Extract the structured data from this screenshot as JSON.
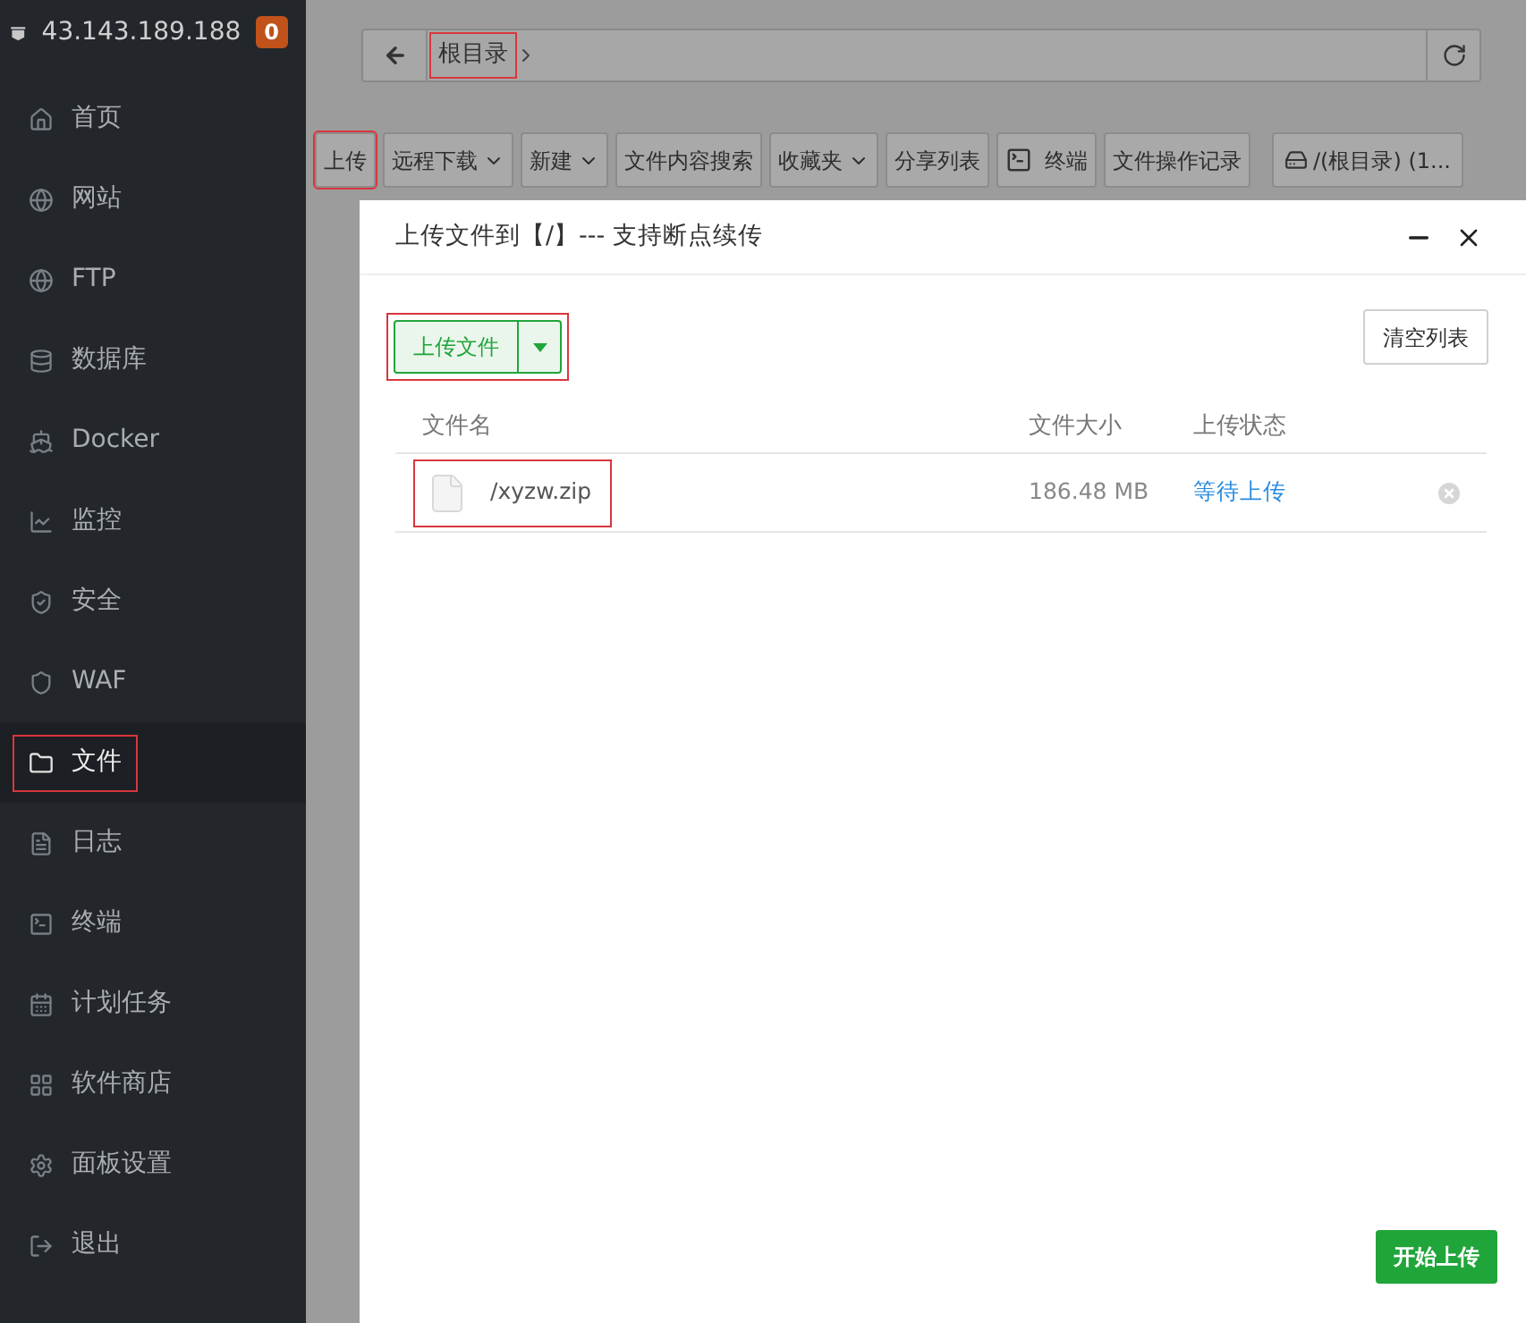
{
  "sidebar": {
    "server_ip": "43.143.189.188",
    "badge": "0",
    "items": [
      {
        "label": "首页",
        "selected": false,
        "annotated": false
      },
      {
        "label": "网站",
        "selected": false,
        "annotated": false
      },
      {
        "label": "FTP",
        "selected": false,
        "annotated": false
      },
      {
        "label": "数据库",
        "selected": false,
        "annotated": false
      },
      {
        "label": "Docker",
        "selected": false,
        "annotated": false
      },
      {
        "label": "监控",
        "selected": false,
        "annotated": false
      },
      {
        "label": "安全",
        "selected": false,
        "annotated": false
      },
      {
        "label": "WAF",
        "selected": false,
        "annotated": false
      },
      {
        "label": "文件",
        "selected": true,
        "annotated": true
      },
      {
        "label": "日志",
        "selected": false,
        "annotated": false
      },
      {
        "label": "终端",
        "selected": false,
        "annotated": false
      },
      {
        "label": "计划任务",
        "selected": false,
        "annotated": false
      },
      {
        "label": "软件商店",
        "selected": false,
        "annotated": false
      },
      {
        "label": "面板设置",
        "selected": false,
        "annotated": false
      },
      {
        "label": "退出",
        "selected": false,
        "annotated": false
      }
    ]
  },
  "breadcrumb": {
    "path": "根目录",
    "annotated": true
  },
  "toolbar": [
    {
      "label": "上传",
      "dropdown": false,
      "annotated": true
    },
    {
      "label": "远程下载",
      "dropdown": true,
      "annotated": false
    },
    {
      "label": "新建",
      "dropdown": true,
      "annotated": false
    },
    {
      "label": "文件内容搜索",
      "dropdown": false,
      "annotated": false
    },
    {
      "label": "收藏夹",
      "dropdown": true,
      "annotated": false
    },
    {
      "label": "分享列表",
      "dropdown": false,
      "annotated": false
    },
    {
      "label": "终端",
      "dropdown": false,
      "annotated": false,
      "kind": "terminal"
    },
    {
      "label": "文件操作记录",
      "dropdown": false,
      "annotated": false
    },
    {
      "label": "/(根目录) (1...",
      "dropdown": false,
      "annotated": false,
      "kind": "disk"
    }
  ],
  "dialog": {
    "title": "上传文件到【/】--- 支持断点续传",
    "upload_button": {
      "label": "上传文件",
      "annotated": true
    },
    "clear_button": "清空列表",
    "table": {
      "columns": [
        "文件名",
        "文件大小",
        "上传状态"
      ],
      "rows": [
        {
          "name": "/xyzw.zip",
          "size": "186.48 MB",
          "status": "等待上传",
          "annotated": true
        }
      ]
    },
    "start_button": "开始上传"
  }
}
